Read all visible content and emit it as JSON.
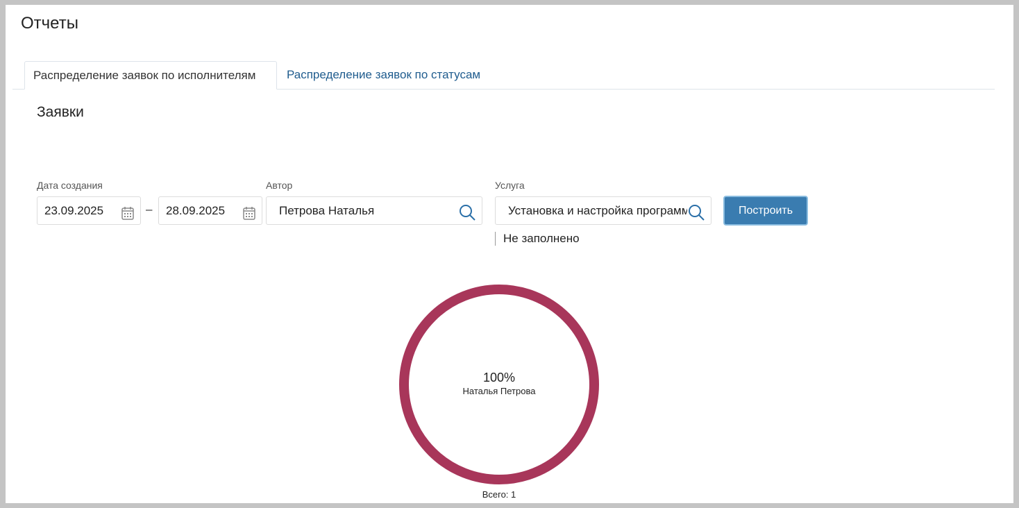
{
  "page": {
    "title": "Отчеты"
  },
  "tabs": [
    {
      "label": "Распределение заявок по исполнителям",
      "active": true
    },
    {
      "label": "Распределение заявок по статусам",
      "active": false
    }
  ],
  "section": {
    "title": "Заявки"
  },
  "filters": {
    "date_label": "Дата создания",
    "date_from": "23.09.2025",
    "date_to": "28.09.2025",
    "date_separator": "–",
    "author_label": "Автор",
    "author_value": "Петрова Наталья",
    "service_label": "Услуга",
    "service_value": "Установка и настройка программ",
    "service_extra": "Не заполнено",
    "build_label": "Построить"
  },
  "chart_data": {
    "type": "pie",
    "style": "donut",
    "color": "#a8365a",
    "slices": [
      {
        "label": "Наталья Петрова",
        "value": 1,
        "percent": "100%"
      }
    ],
    "total_label": "Всего: 1"
  }
}
